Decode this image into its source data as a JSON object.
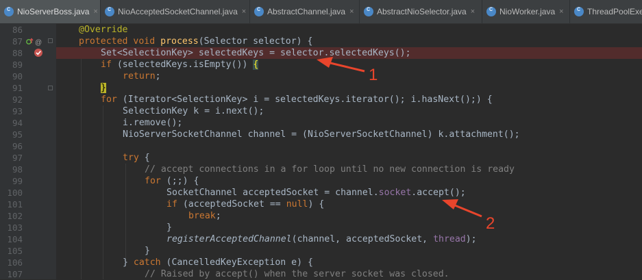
{
  "tabs": [
    {
      "label": "NioServerBoss.java",
      "close": "×",
      "active": true
    },
    {
      "label": "NioAcceptedSocketChannel.java",
      "close": "×",
      "active": false
    },
    {
      "label": "AbstractChannel.java",
      "close": "×",
      "active": false
    },
    {
      "label": "AbstractNioSelector.java",
      "close": "×",
      "active": false
    },
    {
      "label": "NioWorker.java",
      "close": "×",
      "active": false
    },
    {
      "label": "ThreadPoolExec",
      "close": "",
      "active": false
    }
  ],
  "gutter": {
    "line_numbers": [
      "86",
      "87",
      "88",
      "89",
      "90",
      "91",
      "92",
      "93",
      "94",
      "95",
      "96",
      "97",
      "98",
      "99",
      "100",
      "101",
      "102",
      "103",
      "104",
      "105",
      "106",
      "107"
    ]
  },
  "code": {
    "l86": {
      "ann": "@Override"
    },
    "l87": {
      "kw1": "protected",
      "kw2": "void",
      "fn": "process",
      "rest": "(Selector selector) {"
    },
    "l88": {
      "t1": "Set<SelectionKey> selectedKeys = selector.selectedKeys();"
    },
    "l89": {
      "kw": "if",
      "t1": " (selectedKeys.isEmpty()) ",
      "brace": "{"
    },
    "l90": {
      "kw": "return",
      "t1": ";"
    },
    "l91": {
      "brace": "}"
    },
    "l92": {
      "kw": "for",
      "t1": " (Iterator<SelectionKey> i = selectedKeys.iterator(); i.hasNext();) {"
    },
    "l93": {
      "t1": "SelectionKey k = i.next();"
    },
    "l94": {
      "t1": "i.remove();"
    },
    "l95": {
      "t1": "NioServerSocketChannel channel = (NioServerSocketChannel) k.attachment();"
    },
    "l96": {},
    "l97": {
      "kw": "try",
      "t1": " {"
    },
    "l98": {
      "cm": "// accept connections in a for loop until no new connection is ready"
    },
    "l99": {
      "kw": "for",
      "t1": " (;;) {"
    },
    "l100": {
      "t1": "SocketChannel acceptedSocket = channel.",
      "fld": "socket",
      "t2": ".accept();"
    },
    "l101": {
      "kw": "if",
      "t1": " (acceptedSocket == ",
      "kw2": "null",
      "t2": ") {"
    },
    "l102": {
      "kw": "break",
      "t1": ";"
    },
    "l103": {
      "t1": "}"
    },
    "l104": {
      "it": "registerAcceptedChannel",
      "t1": "(channel, acceptedSocket, ",
      "fld": "thread",
      "t2": ");"
    },
    "l105": {
      "t1": "}"
    },
    "l106": {
      "t1": "} ",
      "kw": "catch",
      "t2": " (CancelledKeyException e) {"
    },
    "l107": {
      "cm": "// Raised by accept() when the server socket was closed."
    }
  },
  "annotations": {
    "label1": "1",
    "label2": "2",
    "color": "#e8452c"
  },
  "colors": {
    "keyword": "#cc7832",
    "annotation": "#bbb529",
    "method": "#ffc66d",
    "comment": "#808080",
    "field": "#9876aa",
    "text": "#a9b7c6",
    "background": "#2b2b2b",
    "error_line": "#522c2c"
  },
  "icons": [
    "java-class-icon",
    "override-icon",
    "breakpoint-icon",
    "fold-icon"
  ]
}
